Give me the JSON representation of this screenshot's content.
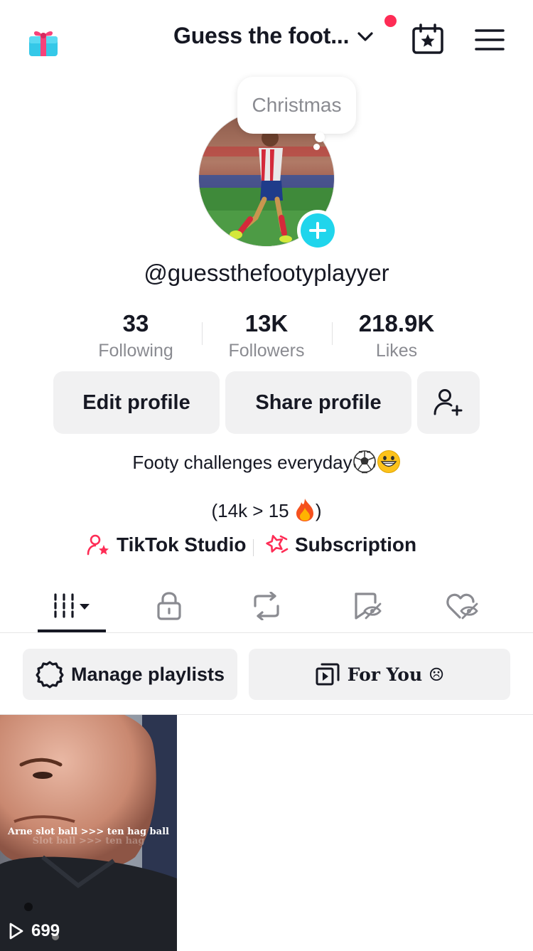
{
  "header": {
    "title": "Guess the foot...",
    "has_notification": true
  },
  "profile": {
    "status_bubble": "Christmas",
    "username": "@guessthefootyplayyer",
    "stats": [
      {
        "value": "33",
        "label": "Following"
      },
      {
        "value": "13K",
        "label": "Followers"
      },
      {
        "value": "218.9K",
        "label": "Likes"
      }
    ],
    "buttons": {
      "edit": "Edit profile",
      "share": "Share profile"
    },
    "bio_line1": "Footy challenges everyday",
    "bio_line2_prefix": "(14k > 15 ",
    "bio_line2_suffix": ")",
    "links": {
      "studio": "TikTok Studio",
      "subscription": "Subscription"
    }
  },
  "tabs": [
    {
      "icon": "videos-grid-icon",
      "active": true
    },
    {
      "icon": "lock-icon",
      "active": false
    },
    {
      "icon": "repost-icon",
      "active": false
    },
    {
      "icon": "favorites-hidden-icon",
      "active": false
    },
    {
      "icon": "liked-hidden-icon",
      "active": false
    }
  ],
  "playlists": {
    "manage_label": "Manage playlists",
    "playlist_label": "For You ☹"
  },
  "videos": [
    {
      "caption": "Arne slot ball >>> ten hag ball",
      "caption_shadow": "Slot ball >>> ten hag",
      "views": "699"
    }
  ],
  "colors": {
    "accent_red": "#fe2c55",
    "accent_cyan": "#20d5ec",
    "button_bg": "#f1f1f2",
    "text_primary": "#161823",
    "text_secondary": "#8a8b91"
  }
}
